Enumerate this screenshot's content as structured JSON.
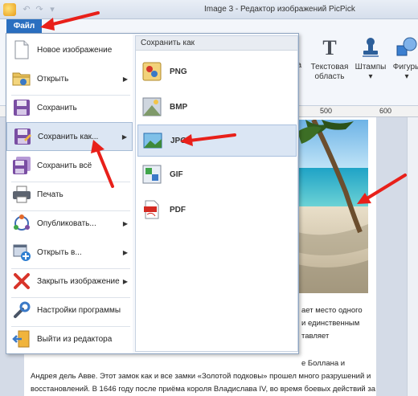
{
  "window": {
    "title": "Image 3 - Редактор изображений PicPick"
  },
  "file_tab": {
    "label": "Файл"
  },
  "ribbon": {
    "partial_label": "ка",
    "text_area": {
      "line1": "Текстовая",
      "line2": "область"
    },
    "stamps": "Штампы",
    "figures": "Фигуры",
    "dropdown_mark": "▾"
  },
  "ruler": {
    "mark1": "500",
    "mark2": "600"
  },
  "doc": {
    "line1": "ает место одного",
    "line2": "и единственным",
    "line3": "тавляет",
    "line4": "е Боллана и",
    "line5": "Андрея дель Авве. Этот замок как и все замки «Золотой подковы» прошел много разрушений и",
    "line6": "восстановлений. В 1646 году после приёма короля Владислава IV, во время боевых действий за"
  },
  "menu": {
    "items": [
      {
        "label": "Новое изображение",
        "icon": "new-image-icon"
      },
      {
        "label": "Открыть",
        "icon": "open-folder-icon",
        "arrow": "▶"
      },
      {
        "label": "Сохранить",
        "icon": "save-icon"
      },
      {
        "label": "Сохранить как...",
        "icon": "save-as-icon",
        "arrow": "▶"
      },
      {
        "label": "Сохранить всё",
        "icon": "save-all-icon"
      },
      {
        "label": "Печать",
        "icon": "print-icon"
      },
      {
        "label": "Опубликовать...",
        "icon": "share-icon",
        "arrow": "▶"
      },
      {
        "label": "Открыть в...",
        "icon": "open-in-icon",
        "arrow": "▶"
      },
      {
        "label": "Закрыть изображение",
        "icon": "close-icon",
        "arrow": "▶"
      },
      {
        "label": "Настройки программы",
        "icon": "settings-icon"
      },
      {
        "label": "Выйти из редактора",
        "icon": "exit-icon"
      }
    ]
  },
  "submenu": {
    "header": "Сохранить как",
    "items": [
      {
        "label": "PNG",
        "icon": "png-file-icon"
      },
      {
        "label": "BMP",
        "icon": "bmp-file-icon"
      },
      {
        "label": "JPG",
        "icon": "jpg-file-icon"
      },
      {
        "label": "GIF",
        "icon": "gif-file-icon"
      },
      {
        "label": "PDF",
        "icon": "pdf-file-icon"
      }
    ]
  },
  "colors": {
    "accent": "#2a6fc0",
    "annotation_arrow": "#e8201a"
  }
}
